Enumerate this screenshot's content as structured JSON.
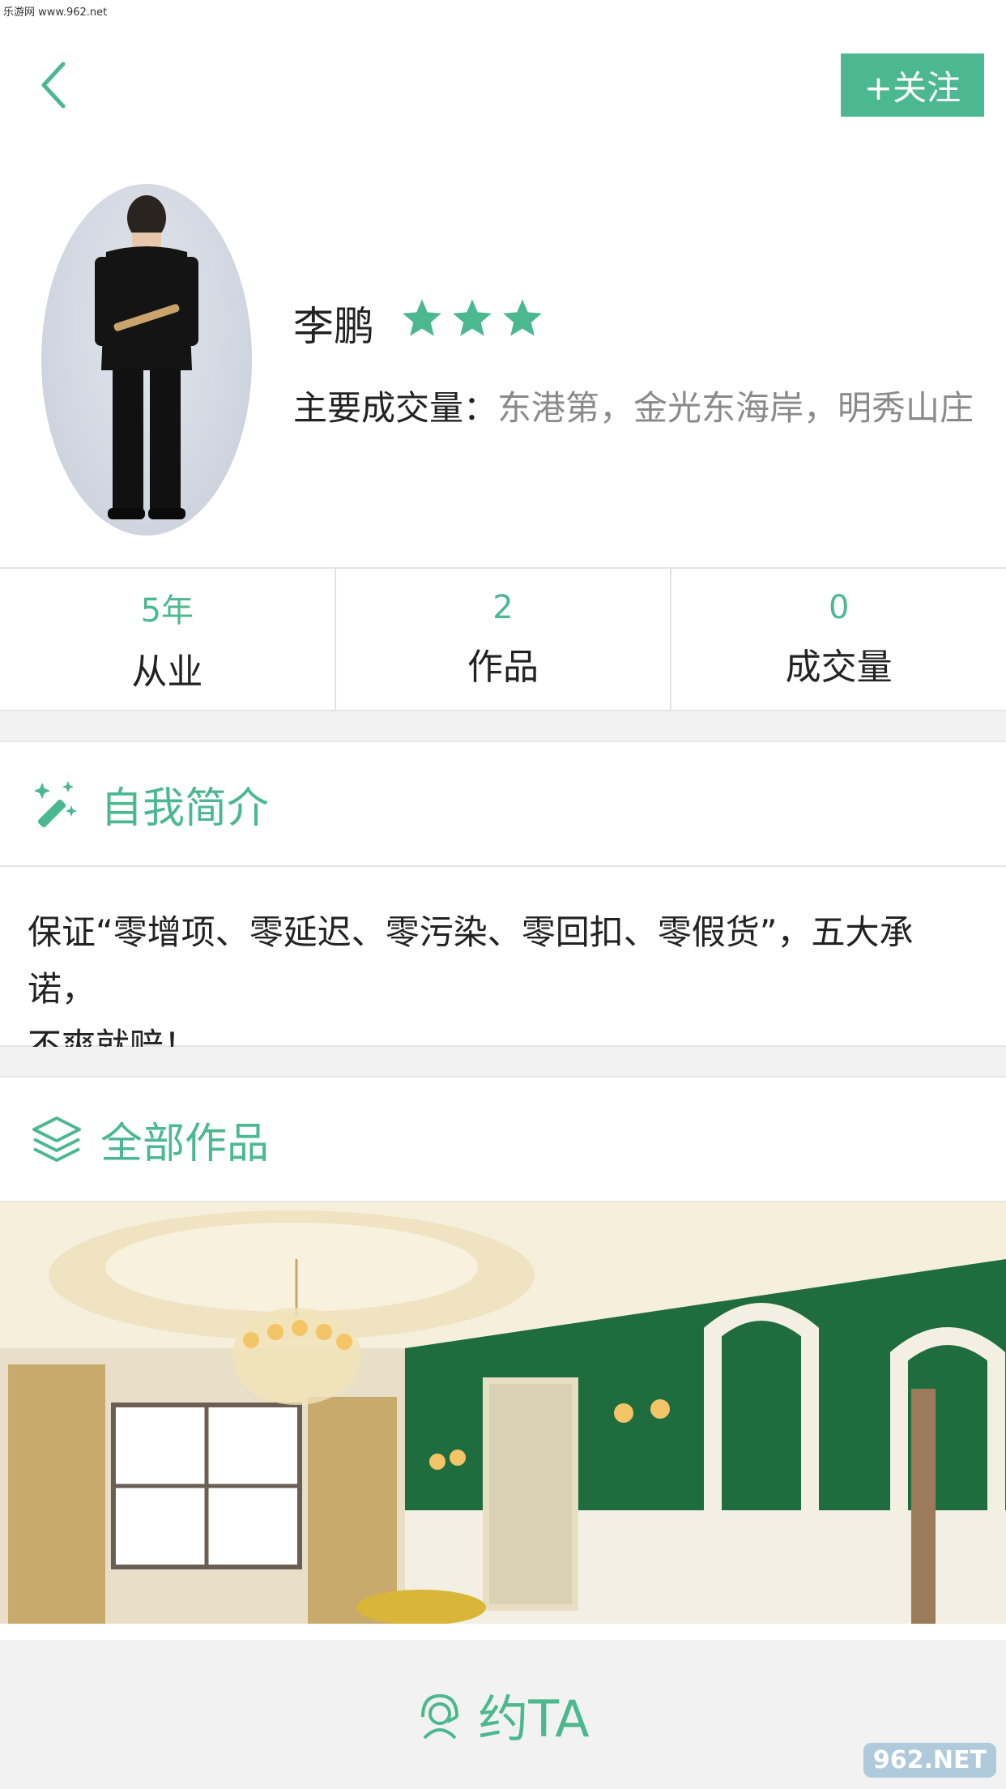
{
  "watermark_top": "乐游网 www.962.net",
  "header": {
    "back_icon": "chevron-left-icon",
    "follow_label": "+关注"
  },
  "profile": {
    "name": "李鹏",
    "rating_stars": 3,
    "tags_label": "主要成交量：",
    "tags_value": "东港第，金光东海岸，明秀山庄"
  },
  "stats": [
    {
      "value": "5年",
      "label": "从业"
    },
    {
      "value": "2",
      "label": "作品"
    },
    {
      "value": "0",
      "label": "成交量"
    }
  ],
  "intro_section": {
    "icon": "magic-wand-icon",
    "title": "自我简介",
    "text_line1": "保证“零增项、零延迟、零污染、零回扣、零假货”，五大承诺，",
    "text_line2": "不爽就赔！"
  },
  "works_section": {
    "icon": "layers-icon",
    "title": "全部作品"
  },
  "bottom_bar": {
    "icon": "headset-icon",
    "label": "约TA"
  },
  "watermark_br": "962.NET",
  "colors": {
    "accent": "#4cb891",
    "divider": "#e6e6e6",
    "muted_text": "#8a8a8a"
  }
}
